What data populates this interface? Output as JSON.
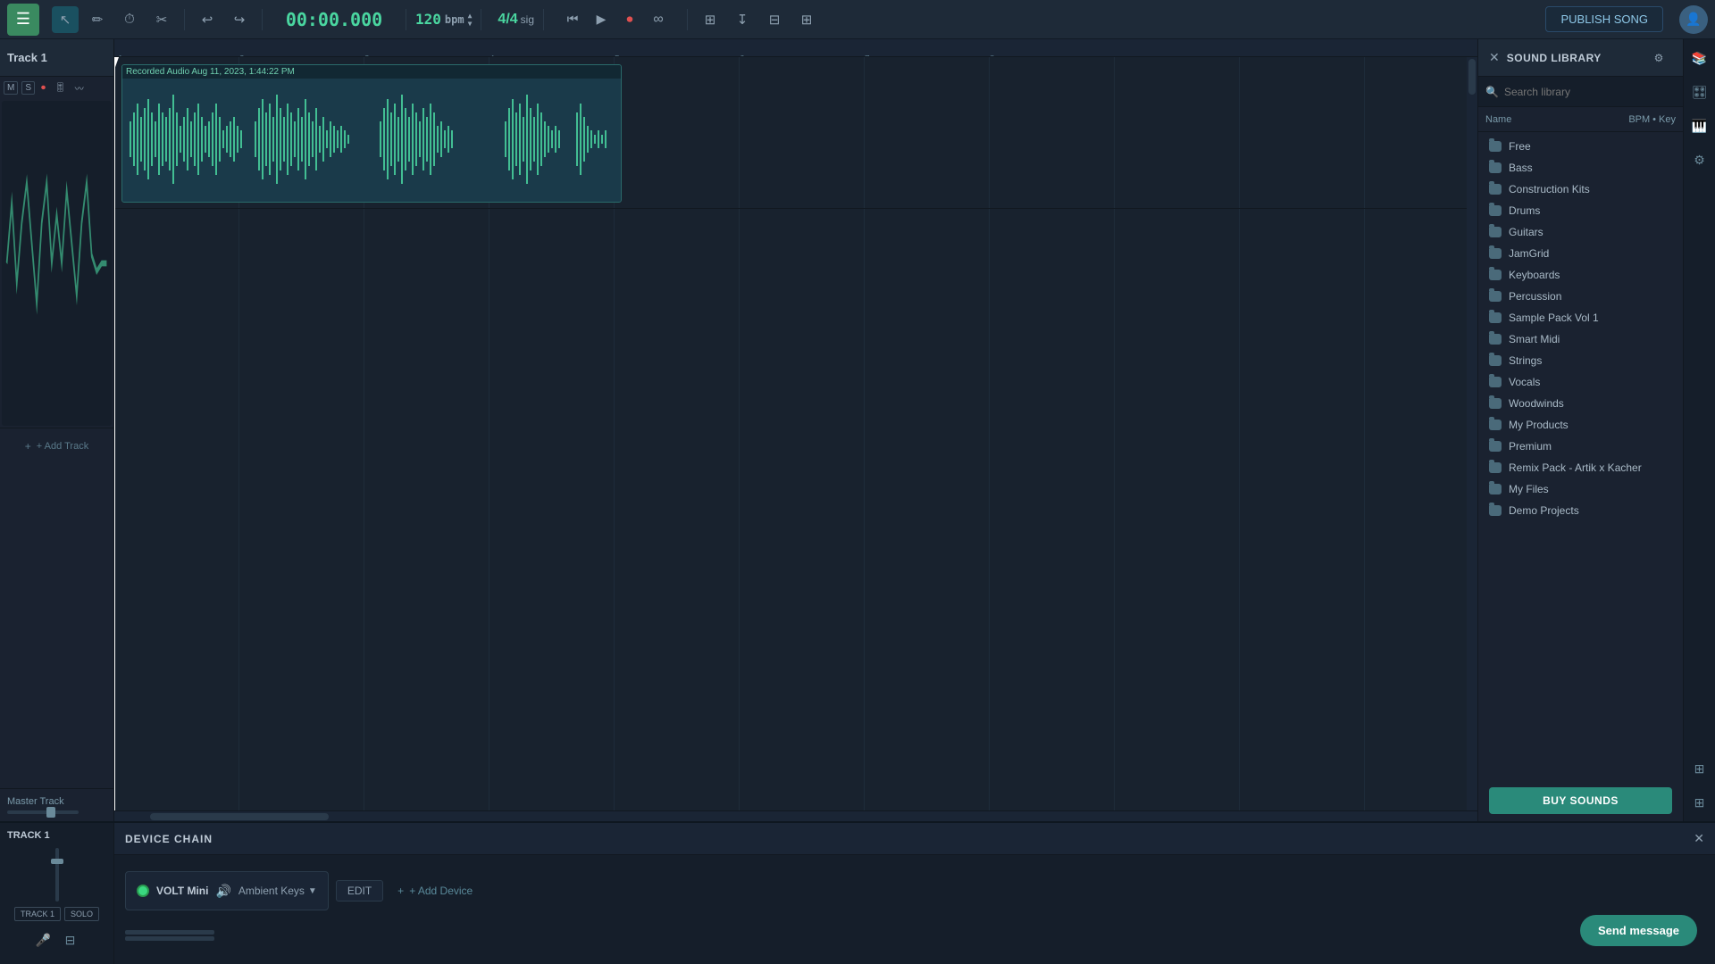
{
  "toolbar": {
    "menu_icon": "☰",
    "cursor_tool": "↖",
    "pencil_tool": "✏",
    "clock_icon": "⏱",
    "scissors_icon": "✂",
    "undo": "↩",
    "redo": "↪",
    "time": "00:00.000",
    "bpm": "120",
    "bpm_label": "bpm",
    "sig": "4/4",
    "sig_label": "sig",
    "skip_back": "⏮",
    "play": "▶",
    "record": "⏺",
    "loop": "⟳",
    "snap": "⊞",
    "publish_label": "PUBLISH SONG"
  },
  "track1": {
    "name": "Track 1",
    "clip_label": "Recorded Audio Aug 11, 2023, 1:44:22 PM",
    "mute_label": "M",
    "solo_label": "S"
  },
  "add_track_label": "+ Add Track",
  "master_track": {
    "label": "Master Track"
  },
  "device_chain": {
    "title": "DEVICE CHAIN",
    "close": "✕",
    "plugin_name": "VOLT Mini",
    "preset_name": "Ambient Keys",
    "edit_label": "EDIT",
    "add_device_label": "+ Add Device",
    "track_label": "TRACK 1"
  },
  "sound_library": {
    "title": "SOUND LIBRARY",
    "close": "✕",
    "search_placeholder": "Search library",
    "col_name": "Name",
    "col_bpm": "BPM",
    "col_key": "Key",
    "items": [
      {
        "name": "Free",
        "type": "folder"
      },
      {
        "name": "Bass",
        "type": "folder"
      },
      {
        "name": "Construction Kits",
        "type": "folder"
      },
      {
        "name": "Drums",
        "type": "folder"
      },
      {
        "name": "Guitars",
        "type": "folder"
      },
      {
        "name": "JamGrid",
        "type": "folder"
      },
      {
        "name": "Keyboards",
        "type": "folder"
      },
      {
        "name": "Percussion",
        "type": "folder"
      },
      {
        "name": "Sample Pack Vol 1",
        "type": "folder"
      },
      {
        "name": "Smart Midi",
        "type": "folder"
      },
      {
        "name": "Strings",
        "type": "folder"
      },
      {
        "name": "Vocals",
        "type": "folder"
      },
      {
        "name": "Woodwinds",
        "type": "folder"
      },
      {
        "name": "My Products",
        "type": "folder"
      },
      {
        "name": "Premium",
        "type": "folder"
      },
      {
        "name": "Remix Pack - Artik x Kacher",
        "type": "folder"
      },
      {
        "name": "My Files",
        "type": "folder"
      },
      {
        "name": "Demo Projects",
        "type": "folder"
      }
    ],
    "buy_sounds_label": "BUY SOUNDS"
  },
  "send_message": {
    "label": "Send message"
  }
}
